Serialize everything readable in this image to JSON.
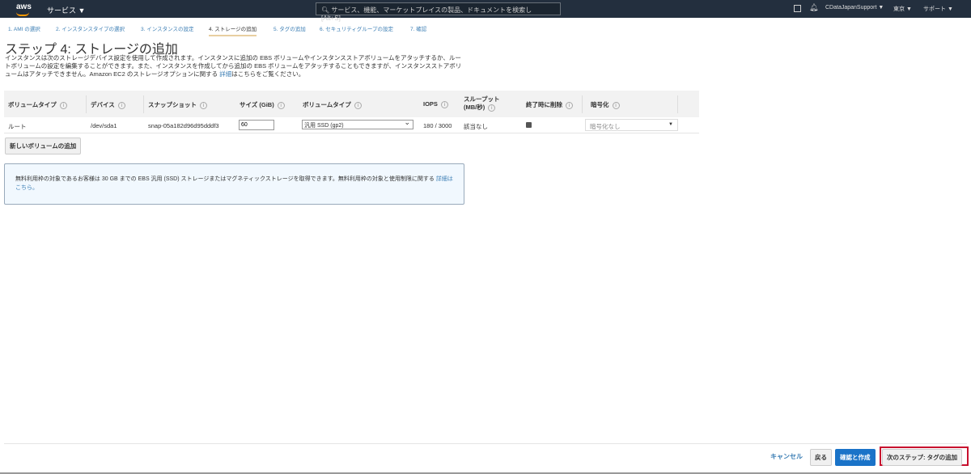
{
  "header": {
    "logo": "aws",
    "services": "サービス ▼",
    "search_placeholder": "サービス、機能、マーケットプレイスの製品、ドキュメントを検索し　[Alt+S]",
    "account": "CDataJapanSupport ▼",
    "region": "東京 ▼",
    "support": "サポート ▼"
  },
  "steps": [
    "1. AMI の選択",
    "2. インスタンスタイプの選択",
    "3. インスタンスの設定",
    "4. ストレージの追加",
    "5. タグの追加",
    "6. セキュリティグループの設定",
    "7. 確認"
  ],
  "title": "ステップ 4: ストレージの追加",
  "description": "インスタンスは次のストレージデバイス設定を使用して作成されます。インスタンスに追加の EBS ボリュームやインスタンスストアボリュームをアタッチするか、ルートボリュームの設定を編集することができます。また、インスタンスを作成してから追加の EBS ボリュームをアタッチすることもできますが、インスタンスストアボリュームはアタッチできません。Amazon EC2 のストレージオプションに関する ",
  "description_link": "詳細",
  "description_end": "はこちらをご覧ください。",
  "table": {
    "headers": [
      "ボリュームタイプ",
      "デバイス",
      "スナップショット",
      "サイズ (GiB)",
      "ボリュームタイプ",
      "IOPS",
      "スループット (MB/秒)",
      "終了時に削除",
      "暗号化"
    ],
    "row": {
      "type": "ルート",
      "device": "/dev/sda1",
      "snapshot": "snap-05a182d96d95dddf3",
      "size": "60",
      "volume_type": "汎用 SSD (gp2)",
      "iops": "180 / 3000",
      "throughput": "該当なし",
      "delete_on_termination": true,
      "encryption": "暗号化なし"
    }
  },
  "add_volume": "新しいボリュームの追加",
  "info": {
    "text": "無料利用枠の対象であるお客様は 30 GB までの EBS 汎用 (SSD) ストレージまたはマグネティックストレージを取得できます。無料利用枠の対象と使用制限に関する ",
    "link": "詳細はこちら。"
  },
  "footer": {
    "cancel": "キャンセル",
    "back": "戻る",
    "review": "確認と作成",
    "next": "次のステップ: タグの追加"
  }
}
